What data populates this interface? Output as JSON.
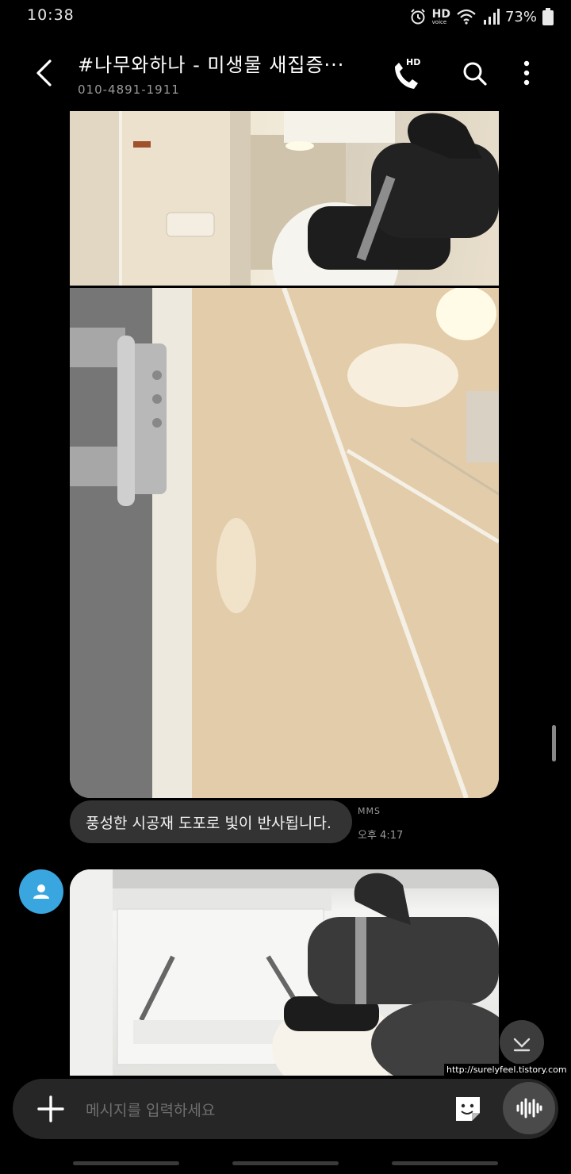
{
  "status_bar": {
    "time": "10:38",
    "hd_top": "HD",
    "hd_bottom": "voice",
    "battery": "73%",
    "icons": [
      "alarm-icon",
      "hd-voice-icon",
      "wifi-icon",
      "signal-icon",
      "battery-icon"
    ]
  },
  "header": {
    "title": "#나무와하나 - 미생물 새집증···",
    "phone": "010-4891-1911",
    "call_badge": "HD",
    "icons": [
      "back-arrow-icon",
      "hd-call-icon",
      "search-icon",
      "more-vert-icon"
    ]
  },
  "message": {
    "text": "풍성한 시공재 도포로 빛이 반사됩니다.",
    "type": "MMS",
    "time": "오후 4:17"
  },
  "composer": {
    "placeholder": "메시지를 입력하세요"
  },
  "watermark": "http://surelyfeel.tistory.com",
  "colors": {
    "background": "#000000",
    "bubble": "#333333",
    "avatar": "#3aa6e0",
    "composer": "#262626"
  }
}
